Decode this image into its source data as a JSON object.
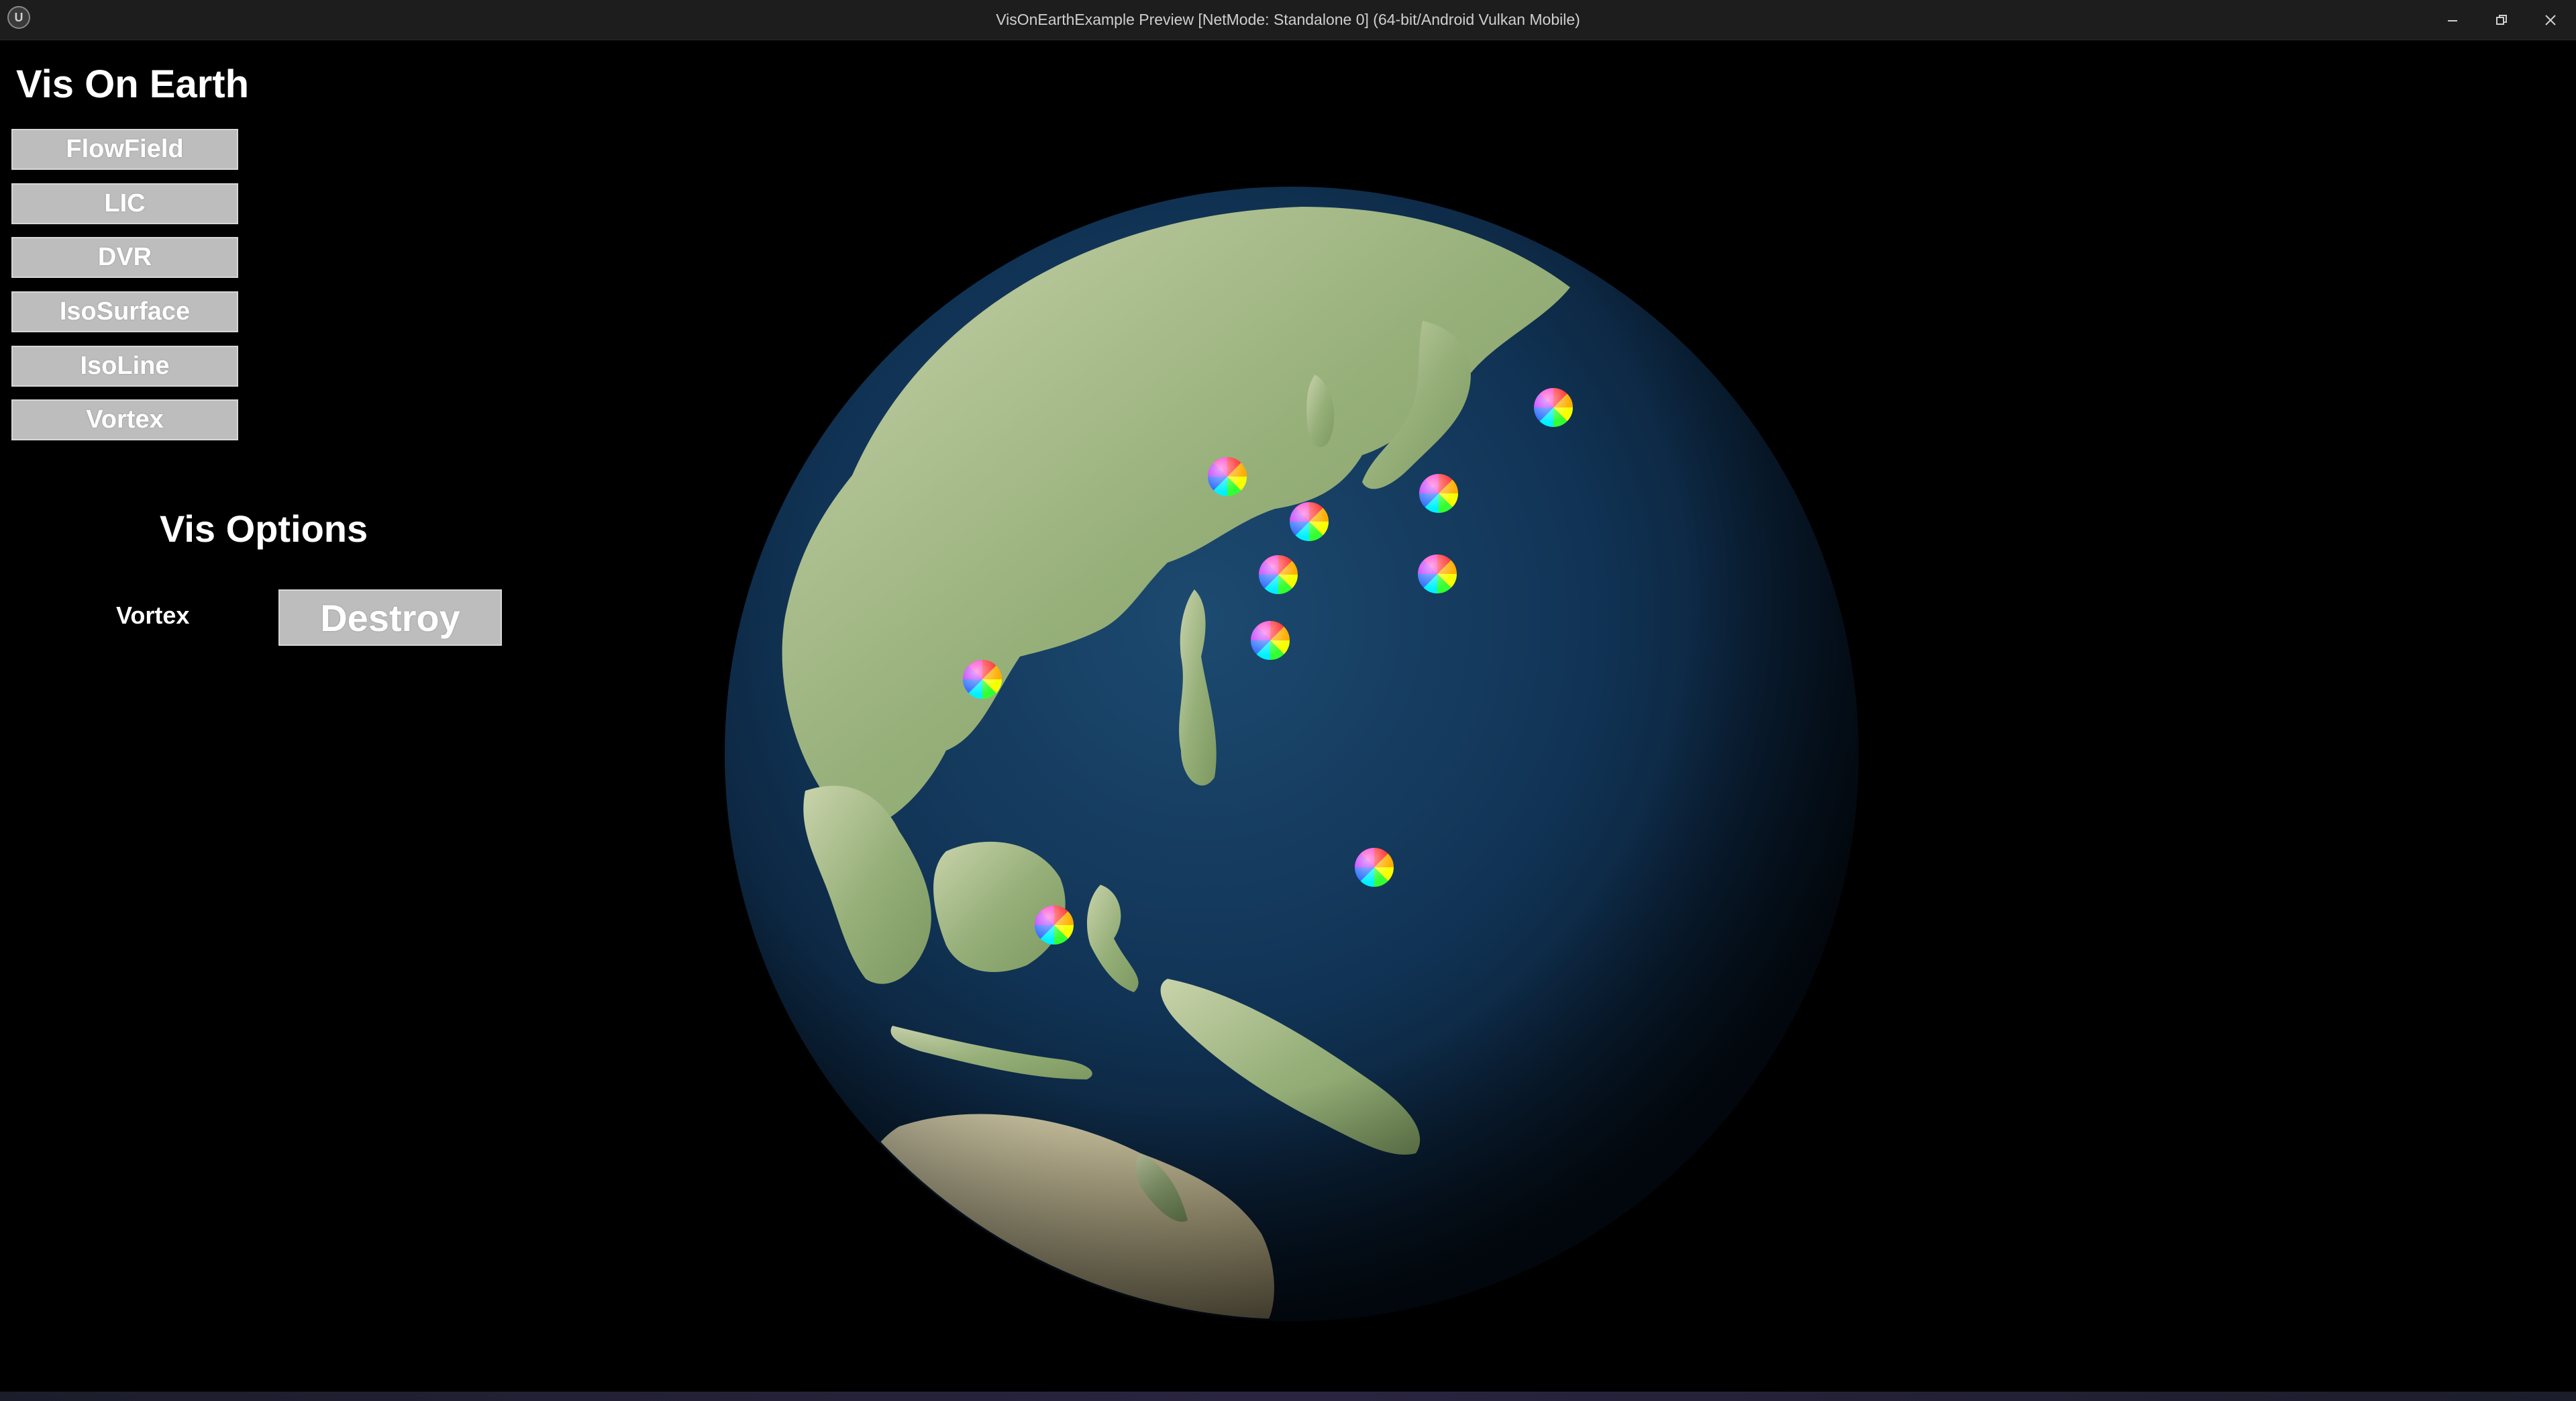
{
  "window": {
    "title": "VisOnEarthExample Preview [NetMode: Standalone 0]  (64-bit/Android Vulkan Mobile)",
    "logo_icon": "unreal-engine-logo-icon",
    "controls": [
      "minimize-icon",
      "restore-icon",
      "close-icon"
    ]
  },
  "app": {
    "title": "Vis On Earth",
    "vis_buttons": [
      {
        "label": "FlowField"
      },
      {
        "label": "LIC"
      },
      {
        "label": "DVR"
      },
      {
        "label": "IsoSurface"
      },
      {
        "label": "IsoLine"
      },
      {
        "label": "Vortex"
      }
    ],
    "options": {
      "title": "Vis Options",
      "current_label": "Vortex",
      "destroy_label": "Destroy"
    }
  },
  "scene": {
    "globe_icon": "earth-globe-icon",
    "vortex_marker_icon": "rainbow-vortex-marker-icon",
    "vortex_marker_count": 10
  },
  "colors": {
    "titlebar": "#1d1d1d",
    "background": "#000000",
    "button": "#bdbdbd",
    "ocean": "#0f2f4c",
    "land": "#9fb88a"
  }
}
